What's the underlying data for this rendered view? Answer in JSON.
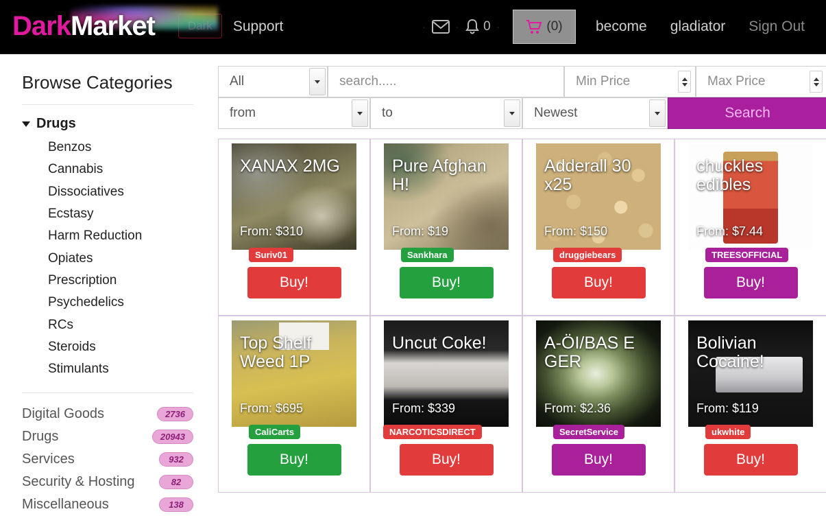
{
  "header": {
    "brand_dark": "Dark",
    "brand_market": "Market",
    "dark_button": "Dark",
    "support_link": "Support",
    "mail_icon": "envelope-icon",
    "bell_icon": "bell-icon",
    "bell_count": "0",
    "cart_icon": "cart-icon",
    "cart_count": "(0)",
    "nav_links": [
      {
        "label": "become",
        "dim": false
      },
      {
        "label": "gladiator",
        "dim": false
      },
      {
        "label": "Sign Out",
        "dim": true
      }
    ]
  },
  "sidebar": {
    "title": "Browse Categories",
    "group": {
      "label": "Drugs",
      "expanded": true,
      "items": [
        "Benzos",
        "Cannabis",
        "Dissociatives",
        "Ecstasy",
        "Harm Reduction",
        "Opiates",
        "Prescription",
        "Psychedelics",
        "RCs",
        "Steroids",
        "Stimulants"
      ]
    },
    "counts": [
      {
        "label": "Digital Goods",
        "count": "2736"
      },
      {
        "label": "Drugs",
        "count": "20943"
      },
      {
        "label": "Services",
        "count": "932"
      },
      {
        "label": "Security & Hosting",
        "count": "82"
      },
      {
        "label": "Miscellaneous",
        "count": "138"
      }
    ]
  },
  "filters": {
    "category_value": "All",
    "search_placeholder": "search.....",
    "search_value": "",
    "min_price_placeholder": "Min Price",
    "max_price_placeholder": "Max Price",
    "from_value": "from",
    "to_value": "to",
    "sort_value": "Newest",
    "search_button": "Search"
  },
  "colors": {
    "accent_magenta": "#aa1f9e",
    "buy_red": "#e23b3b",
    "buy_green": "#24a03f",
    "buy_magenta": "#a8219a",
    "badge_pink": "#e9a7d8",
    "card_border": "#d9c6de",
    "topbar_black": "#000000"
  },
  "products": [
    {
      "title": "XANAX 2MG",
      "price": "From: $310",
      "vendor": "Suriv01",
      "vendor_color": "red",
      "buy_label": "Buy!",
      "buy_color": "red"
    },
    {
      "title": "Pure Afghan H!",
      "price": "From: $19",
      "vendor": "Sankhara",
      "vendor_color": "green",
      "buy_label": "Buy!",
      "buy_color": "green"
    },
    {
      "title": "Adderall 30 x25",
      "price": "From: $150",
      "vendor": "druggiebears",
      "vendor_color": "red",
      "buy_label": "Buy!",
      "buy_color": "red"
    },
    {
      "title": "chuckles edibles",
      "price": "From: $7.44",
      "vendor": "TREESOFFICIAL",
      "vendor_color": "magenta",
      "buy_label": "Buy!",
      "buy_color": "magenta"
    },
    {
      "title": "Top Shelf Weed 1P",
      "price": "From: $695",
      "vendor": "CaliCarts",
      "vendor_color": "green",
      "buy_label": "Buy!",
      "buy_color": "green"
    },
    {
      "title": "Uncut Coke!",
      "price": "From: $339",
      "vendor": "NARCOTICSDIRECT",
      "vendor_color": "red",
      "buy_label": "Buy!",
      "buy_color": "red"
    },
    {
      "title": "A-ÖI/BAS E GER",
      "price": "From: $2.36",
      "vendor": "SecretService",
      "vendor_color": "magenta",
      "buy_label": "Buy!",
      "buy_color": "magenta"
    },
    {
      "title": "Bolivian Cocaine!",
      "price": "From: $119",
      "vendor": "ukwhite",
      "vendor_color": "red",
      "buy_label": "Buy!",
      "buy_color": "red"
    }
  ]
}
